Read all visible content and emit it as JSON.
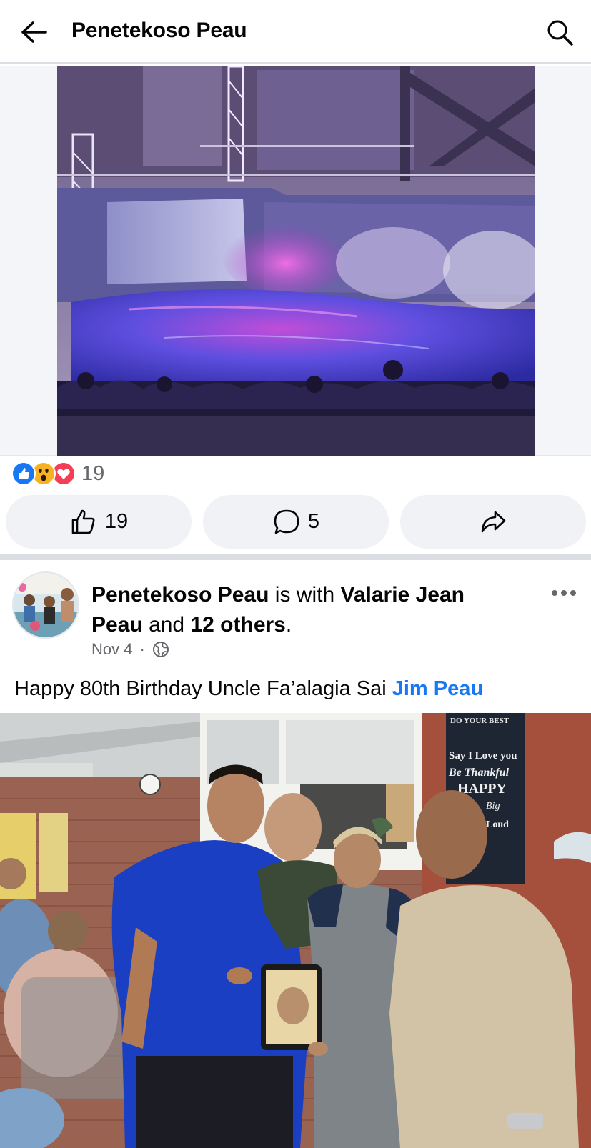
{
  "header": {
    "title": "Penetekoso Peau"
  },
  "post1": {
    "reaction_count": "19",
    "like_count": "19",
    "comment_count": "5"
  },
  "post2": {
    "author": "Penetekoso Peau",
    "with_text": "is with",
    "tagged": "Valarie Jean Peau",
    "and_text": "and",
    "others": "12 others",
    "period": ".",
    "date": "Nov 4",
    "separator": "·",
    "text": "Happy 80th Birthday Uncle Fa’alagia Sai",
    "mention": "Jim Peau"
  },
  "sign_text": [
    "DO YOUR BEST",
    "Say I Love you",
    "Be Thankful",
    "HAPPY",
    "Big",
    "Loud"
  ],
  "colors": {
    "link_blue": "#1877f2",
    "like_blue": "#1877f2",
    "love_red": "#f33e58",
    "wow_yellow": "#f7b125",
    "button_bg": "#f0f2f5",
    "divider": "#dadde1",
    "secondary_text": "#65676b"
  },
  "icons": [
    "back-arrow-icon",
    "search-icon",
    "like-reaction-icon",
    "wow-reaction-icon",
    "love-reaction-icon",
    "thumbs-up-icon",
    "comment-icon",
    "share-icon",
    "more-dots-icon",
    "globe-icon"
  ]
}
